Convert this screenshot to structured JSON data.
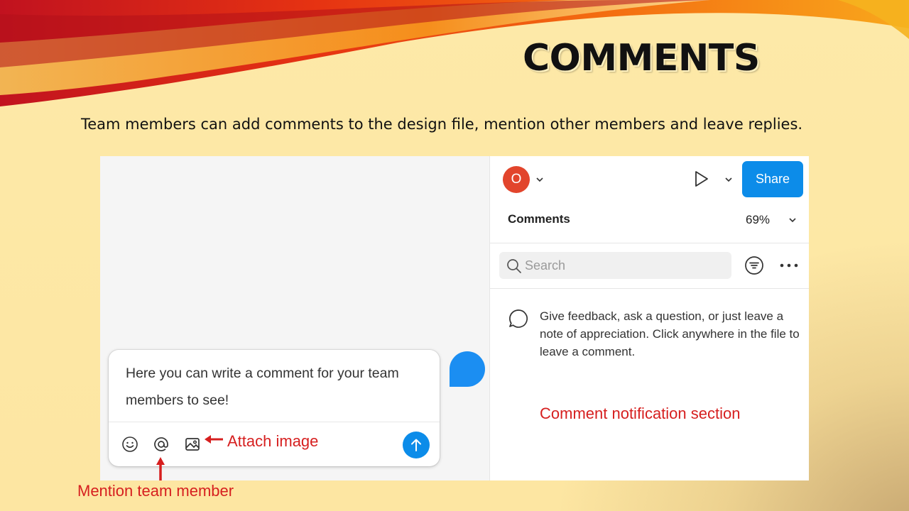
{
  "slide": {
    "title": "COMMENTS",
    "subtitle": "Team members can add comments to the design file, mention other members and leave replies."
  },
  "header": {
    "avatar_letter": "O",
    "share_label": "Share"
  },
  "comments_panel": {
    "label": "Comments",
    "zoom": "69%",
    "search_placeholder": "Search",
    "empty_message": "Give feedback, ask a question, or just leave a note of appreciation. Click anywhere in the file to leave a comment."
  },
  "composer": {
    "text": "Here you can write a comment for your team members to see!"
  },
  "annotations": {
    "attach": "Attach image",
    "mention": "Mention team member",
    "notification": "Comment notification section"
  },
  "colors": {
    "accent": "#0c8ce9",
    "avatar": "#e2452c",
    "annotation": "#d61f1f"
  },
  "icons": [
    "emoji-icon",
    "at-icon",
    "image-icon",
    "send-icon",
    "play-icon",
    "filter-icon",
    "more-icon",
    "comment-bubble-icon",
    "search-icon"
  ]
}
